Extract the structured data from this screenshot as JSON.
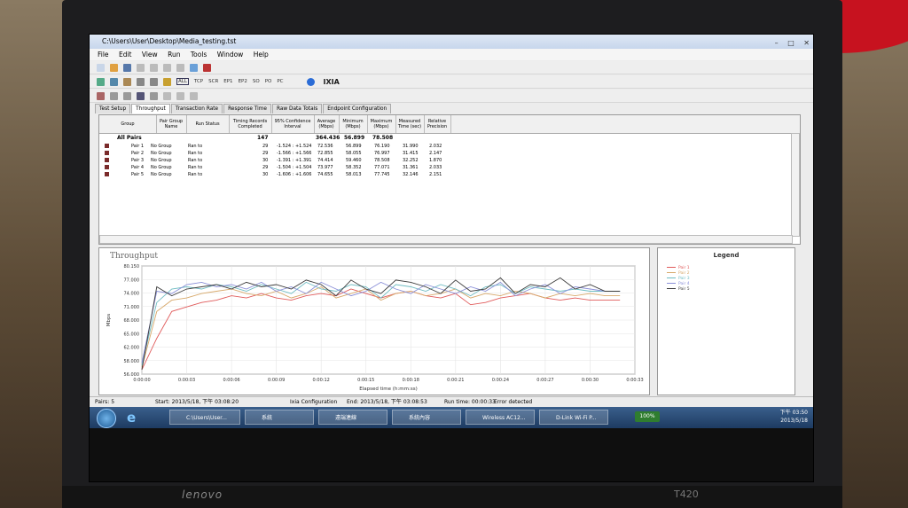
{
  "window": {
    "title": "C:\\Users\\User\\Desktop\\Media_testing.tst"
  },
  "menu": [
    "File",
    "Edit",
    "View",
    "Run",
    "Tools",
    "Window",
    "Help"
  ],
  "toolbar": {
    "labels": [
      "ALL",
      "TCP",
      "SCR",
      "EP1",
      "EP2",
      "SO",
      "PO",
      "PC"
    ],
    "brand": "IXIA"
  },
  "tabs": [
    "Test Setup",
    "Throughput",
    "Transaction Rate",
    "Response Time",
    "Raw Data Totals",
    "Endpoint Configuration"
  ],
  "table": {
    "headers": [
      "Group",
      "Pair Group Name",
      "Run Status",
      "Timing Records Completed",
      "95% Confidence Interval",
      "Average (Mbps)",
      "Minimum (Mbps)",
      "Maximum (Mbps)",
      "Measured Time (sec)",
      "Relative Precision"
    ],
    "all_pairs": {
      "label": "All Pairs",
      "records": "147",
      "average": "364.436",
      "minimum": "56.899",
      "maximum": "78.508"
    },
    "rows": [
      {
        "pair": "Pair 1",
        "group": "No Group",
        "status": "Ran to",
        "records": "29",
        "ci": "-1.524 : +1.524",
        "avg": "72.536",
        "min": "56.899",
        "max": "76.190",
        "time": "31.990",
        "rp": "2.032"
      },
      {
        "pair": "Pair 2",
        "group": "No Group",
        "status": "Ran to",
        "records": "29",
        "ci": "-1.566 : +1.566",
        "avg": "72.855",
        "min": "58.055",
        "max": "76.997",
        "time": "31.415",
        "rp": "2.147"
      },
      {
        "pair": "Pair 3",
        "group": "No Group",
        "status": "Ran to",
        "records": "30",
        "ci": "-1.391 : +1.391",
        "avg": "74.414",
        "min": "59.460",
        "max": "78.508",
        "time": "32.252",
        "rp": "1.870"
      },
      {
        "pair": "Pair 4",
        "group": "No Group",
        "status": "Ran to",
        "records": "29",
        "ci": "-1.504 : +1.504",
        "avg": "73.977",
        "min": "58.352",
        "max": "77.071",
        "time": "31.361",
        "rp": "2.033"
      },
      {
        "pair": "Pair 5",
        "group": "No Group",
        "status": "Ran to",
        "records": "30",
        "ci": "-1.606 : +1.606",
        "avg": "74.655",
        "min": "58.013",
        "max": "77.745",
        "time": "32.146",
        "rp": "2.151"
      }
    ]
  },
  "chart_data": {
    "type": "line",
    "title": "Throughput",
    "xlabel": "Elapsed time (h:mm:ss)",
    "ylabel": "Mbps",
    "x_tick_labels": [
      "0:00:00",
      "0:00:03",
      "0:00:06",
      "0:00:09",
      "0:00:12",
      "0:00:15",
      "0:00:18",
      "0:00:21",
      "0:00:24",
      "0:00:27",
      "0:00:30",
      "0:00:33"
    ],
    "y_tick_labels": [
      "56.000",
      "58.000",
      "62.000",
      "65.000",
      "68.000",
      "71.000",
      "74.000",
      "77.000",
      "80.150"
    ],
    "xlim": [
      0,
      33
    ],
    "ylim": [
      56.0,
      80.15
    ],
    "grid": true,
    "legend": "right-panel",
    "series": [
      {
        "name": "Pair 1",
        "color": "#e05a5a",
        "x": [
          0,
          1,
          2,
          3,
          4,
          5,
          6,
          7,
          8,
          9,
          10,
          11,
          12,
          13,
          14,
          15,
          16,
          17,
          18,
          19,
          20,
          21,
          22,
          23,
          24,
          25,
          26,
          27,
          28,
          29,
          30,
          31,
          32
        ],
        "values": [
          57.0,
          64.0,
          70.0,
          71.0,
          72.0,
          72.5,
          73.5,
          73.0,
          74.0,
          73.0,
          72.5,
          73.5,
          74.0,
          73.5,
          75.0,
          74.0,
          73.0,
          74.0,
          74.5,
          73.5,
          73.0,
          74.0,
          71.5,
          72.0,
          73.0,
          73.5,
          74.0,
          73.0,
          72.5,
          73.0,
          72.5,
          72.5,
          72.5
        ]
      },
      {
        "name": "Pair 2",
        "color": "#d7a86a",
        "x": [
          0,
          1,
          2,
          3,
          4,
          5,
          6,
          7,
          8,
          9,
          10,
          11,
          12,
          13,
          14,
          15,
          16,
          17,
          18,
          19,
          20,
          21,
          22,
          23,
          24,
          25,
          26,
          27,
          28,
          29,
          30,
          31,
          32
        ],
        "values": [
          57.5,
          70.0,
          72.5,
          73.0,
          74.0,
          74.5,
          75.0,
          74.0,
          73.5,
          74.5,
          73.0,
          74.0,
          75.5,
          73.0,
          74.0,
          75.0,
          72.5,
          74.0,
          74.5,
          73.5,
          74.0,
          75.0,
          73.0,
          74.0,
          73.5,
          74.5,
          74.0,
          73.0,
          74.0,
          73.5,
          74.0,
          73.5,
          73.5
        ]
      },
      {
        "name": "Pair 3",
        "color": "#6fbcc2",
        "x": [
          0,
          1,
          2,
          3,
          4,
          5,
          6,
          7,
          8,
          9,
          10,
          11,
          12,
          13,
          14,
          15,
          16,
          17,
          18,
          19,
          20,
          21,
          22,
          23,
          24,
          25,
          26,
          27,
          28,
          29,
          30,
          31,
          32
        ],
        "values": [
          58.0,
          72.0,
          75.0,
          75.5,
          75.0,
          76.0,
          75.5,
          74.5,
          76.0,
          75.0,
          74.0,
          76.5,
          75.0,
          74.5,
          76.0,
          75.5,
          73.0,
          76.0,
          75.5,
          74.5,
          76.0,
          75.0,
          73.5,
          75.5,
          76.0,
          74.0,
          75.5,
          75.0,
          74.5,
          75.0,
          74.5,
          74.5,
          74.5
        ]
      },
      {
        "name": "Pair 4",
        "color": "#8a8fd8",
        "x": [
          0,
          1,
          2,
          3,
          4,
          5,
          6,
          7,
          8,
          9,
          10,
          11,
          12,
          13,
          14,
          15,
          16,
          17,
          18,
          19,
          20,
          21,
          22,
          23,
          24,
          25,
          26,
          27,
          28,
          29,
          30,
          31,
          32
        ],
        "values": [
          58.5,
          74.5,
          74.0,
          76.0,
          76.5,
          75.5,
          76.0,
          75.0,
          76.5,
          74.5,
          75.5,
          74.0,
          76.5,
          75.0,
          73.5,
          74.5,
          76.5,
          75.0,
          74.0,
          76.0,
          75.0,
          74.0,
          75.5,
          74.5,
          76.5,
          73.5,
          75.0,
          76.0,
          74.0,
          75.5,
          75.0,
          74.5,
          74.5
        ]
      },
      {
        "name": "Pair 5",
        "color": "#3c3c3c",
        "x": [
          0,
          1,
          2,
          3,
          4,
          5,
          6,
          7,
          8,
          9,
          10,
          11,
          12,
          13,
          14,
          15,
          16,
          17,
          18,
          19,
          20,
          21,
          22,
          23,
          24,
          25,
          26,
          27,
          28,
          29,
          30,
          31,
          32
        ],
        "values": [
          57.0,
          75.5,
          73.5,
          75.0,
          75.5,
          76.0,
          75.0,
          76.5,
          75.5,
          76.0,
          75.0,
          77.0,
          76.0,
          73.5,
          77.0,
          75.0,
          74.0,
          77.0,
          76.5,
          75.5,
          74.0,
          77.0,
          74.5,
          75.0,
          77.5,
          74.0,
          76.0,
          75.5,
          77.5,
          75.0,
          76.0,
          74.5,
          74.5
        ]
      }
    ]
  },
  "legend": {
    "title": "Legend",
    "items": [
      "Pair 1",
      "Pair 2",
      "Pair 3",
      "Pair 4",
      "Pair 5"
    ]
  },
  "status": {
    "pairs": "Pairs: 5",
    "start": "Start: 2013/5/18, 下午 03:08:20",
    "config": "Ixia Configuration",
    "end": "End: 2013/5/18, 下午 03:08:53",
    "runtime": "Run time: 00:00:33",
    "error": "Error detected"
  },
  "taskbar": {
    "buttons": [
      "C:\\Users\\User...",
      "系統",
      "遠端連線",
      "系統內容",
      "Wireless AC12...",
      "D-Link Wi-Fi P..."
    ],
    "zoom": "100%",
    "time": "下午 03:50",
    "date": "2013/5/18"
  },
  "bezel": {
    "brand": "lenovo",
    "model": "T420"
  }
}
